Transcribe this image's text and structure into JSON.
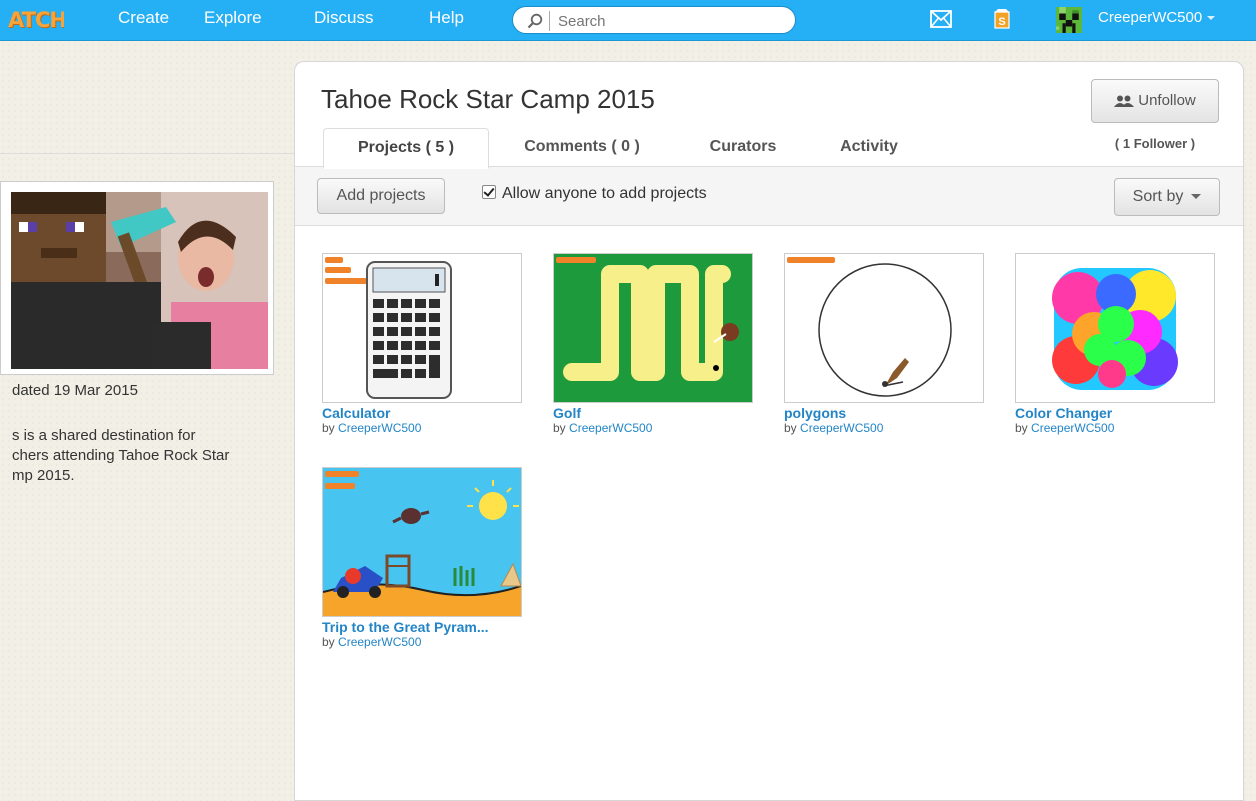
{
  "nav": {
    "logo": "ATCH",
    "links": [
      "Create",
      "Explore",
      "Discuss",
      "Help"
    ],
    "search_placeholder": "Search",
    "username": "CreeperWC500",
    "mystuff_badge": "S"
  },
  "studio": {
    "title": "Tahoe Rock Star Camp 2015",
    "unfollow_label": "Unfollow",
    "followers": "( 1 Follower )",
    "updated": "dated 19 Mar 2015",
    "description_lines": [
      "s is a shared destination for",
      "chers attending Tahoe Rock Star",
      "mp 2015."
    ]
  },
  "tabs": [
    "Projects ( 5 )",
    "Comments ( 0 )",
    "Curators",
    "Activity"
  ],
  "toolbar": {
    "add_label": "Add projects",
    "allow_label": "Allow anyone to add projects",
    "sort_label": "Sort by"
  },
  "projects": [
    {
      "title": "Calculator",
      "by": "by",
      "author": "CreeperWC500"
    },
    {
      "title": "Golf",
      "by": "by",
      "author": "CreeperWC500"
    },
    {
      "title": "polygons",
      "by": "by",
      "author": "CreeperWC500"
    },
    {
      "title": "Color Changer",
      "by": "by",
      "author": "CreeperWC500"
    },
    {
      "title": "Trip to the Great Pyram...",
      "by": "by",
      "author": "CreeperWC500"
    }
  ],
  "colors": {
    "nav_bg": "#25aff4",
    "link": "#2385c6",
    "golf_green": "#1c9a3c",
    "sky": "#47c4f0",
    "sand": "#f7a52a"
  }
}
